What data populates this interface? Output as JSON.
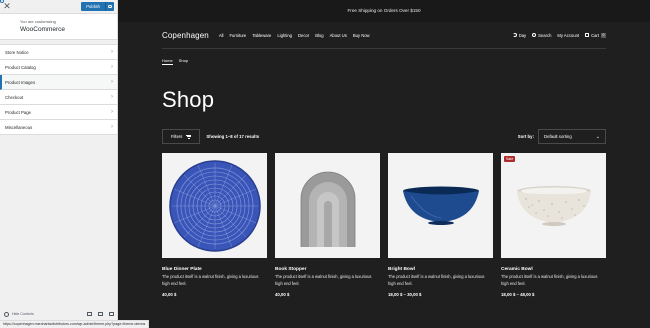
{
  "customizer": {
    "publish_label": "Publish",
    "customizing_label": "You are customizing",
    "site_name": "WooCommerce",
    "menu": [
      {
        "label": "Store Notice"
      },
      {
        "label": "Product Catalog"
      },
      {
        "label": "Product Images",
        "active": true
      },
      {
        "label": "Checkout"
      },
      {
        "label": "Product Page"
      },
      {
        "label": "Miscellaneous"
      }
    ],
    "hide_controls_label": "Hide Controls",
    "status_url": "https://copenhagen.merchantsdistributors.com/wp-admin/theme.php?page=theme-demos"
  },
  "site": {
    "promo_text": "Free Shipping on Orders Over $150",
    "logo": "Copenhagen",
    "nav": [
      "All",
      "Furniture",
      "Tableware",
      "Lighting",
      "Decor",
      "Blog",
      "About Us",
      "Buy Now"
    ],
    "day_label": "Day",
    "search_label": "Search",
    "account_label": "My Account",
    "cart_label": "Cart",
    "cart_count": "0",
    "breadcrumb": [
      "Home",
      "Shop"
    ],
    "page_title": "Shop",
    "filters_label": "Filters",
    "results_text": "Showing 1–8 of 17 results",
    "sort_label": "Sort by:",
    "sort_value": "Default sorting",
    "sale_badge": "Sale",
    "products": [
      {
        "name": "Blue Dinner Plate",
        "desc": "The product itself is a walnut finish, giving a luxurious high end feel.",
        "price": "40,00 $",
        "sale": false
      },
      {
        "name": "Book Stopper",
        "desc": "The product itself is a walnut finish, giving a luxurious high end feel.",
        "price": "40,00 $",
        "sale": false
      },
      {
        "name": "Bright Bowl",
        "desc": "The product itself is a walnut finish, giving a luxurious high end feel.",
        "price": "18,00 $ – 30,00 $",
        "sale": false
      },
      {
        "name": "Ceramic Bowl",
        "desc": "The product itself is a walnut finish, giving a luxurious high end feel.",
        "price": "18,00 $ – 48,00 $",
        "sale": true
      }
    ]
  },
  "colors": {
    "admin_blue": "#2271b1",
    "preview_bg": "#1f1f1f",
    "sale_red": "#b02c2c"
  },
  "icons": [
    "close-icon",
    "gear-icon",
    "chevron-right-icon",
    "moon-icon",
    "search-icon",
    "cart-icon",
    "filter-icon",
    "chevron-down-icon",
    "hide-controls-icon",
    "desktop-icon",
    "tablet-icon",
    "mobile-icon"
  ]
}
